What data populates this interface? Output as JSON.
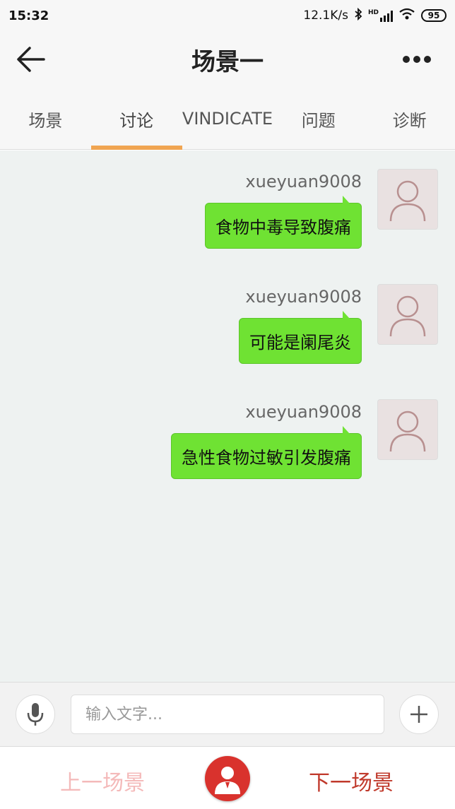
{
  "status_bar": {
    "time": "15:32",
    "network_speed": "12.1K/s",
    "network_type": "HD",
    "battery": "95"
  },
  "header": {
    "title": "场景一"
  },
  "tabs": [
    {
      "label": "场景"
    },
    {
      "label": "讨论"
    },
    {
      "label": "VINDICATE"
    },
    {
      "label": "问题"
    },
    {
      "label": "诊断"
    }
  ],
  "messages": [
    {
      "username": "xueyuan9008",
      "text": "食物中毒导致腹痛"
    },
    {
      "username": "xueyuan9008",
      "text": "可能是阑尾炎"
    },
    {
      "username": "xueyuan9008",
      "text": "急性食物过敏引发腹痛"
    }
  ],
  "input": {
    "placeholder": "输入文字..."
  },
  "bottom_nav": {
    "prev_label": "上一场景",
    "next_label": "下一场景"
  },
  "colors": {
    "accent_tab": "#f0a552",
    "bubble": "#6fe233",
    "center_button": "#d9322d",
    "next": "#c0392b",
    "prev_disabled": "#f4b9b9"
  }
}
